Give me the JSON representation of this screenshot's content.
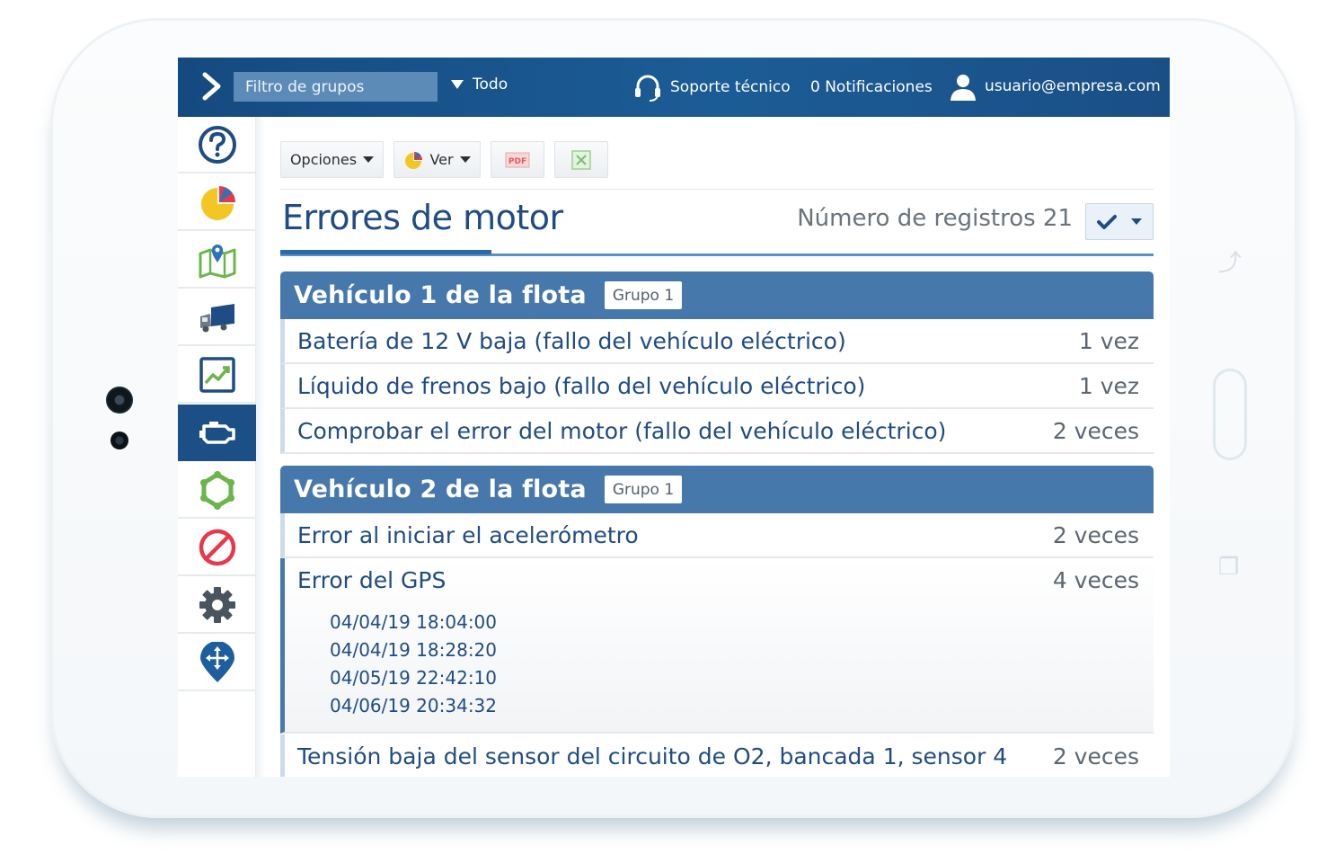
{
  "topbar": {
    "filter_placeholder": "Filtro de grupos",
    "scope_label": "Todo",
    "support_label": "Soporte técnico",
    "notifications_label": "0 Notificaciones",
    "user_email": "usuario@empresa.com"
  },
  "sidebar": {
    "items": [
      {
        "icon": "help-icon"
      },
      {
        "icon": "pie-chart-icon"
      },
      {
        "icon": "map-icon"
      },
      {
        "icon": "truck-icon"
      },
      {
        "icon": "trend-chart-icon"
      },
      {
        "icon": "engine-icon",
        "active": true
      },
      {
        "icon": "rules-icon"
      },
      {
        "icon": "forbidden-icon"
      },
      {
        "icon": "gear-icon"
      },
      {
        "icon": "location-arrows-icon"
      }
    ]
  },
  "toolbar": {
    "options_label": "Opciones",
    "view_label": "Ver",
    "pdf_label": "PDF"
  },
  "page": {
    "title": "Errores de motor",
    "record_count_label": "Número de registros 21"
  },
  "groups": [
    {
      "name": "Vehículo 1 de la flota",
      "badge": "Grupo 1",
      "rows": [
        {
          "name": "Batería de 12 V baja (fallo del vehículo eléctrico)",
          "count": "1 vez"
        },
        {
          "name": "Líquido de frenos bajo (fallo del vehículo eléctrico)",
          "count": "1 vez"
        },
        {
          "name": "Comprobar el error del motor (fallo del vehículo eléctrico)",
          "count": "2 veces"
        }
      ]
    },
    {
      "name": "Vehículo 2 de la flota",
      "badge": "Grupo 1",
      "rows": [
        {
          "name": "Error al iniciar el acelerómetro",
          "count": "2 veces"
        },
        {
          "name": "Error del GPS",
          "count": "4 veces",
          "timestamps": [
            "04/04/19 18:04:00",
            "04/04/19 18:28:20",
            "04/05/19 22:42:10",
            "04/06/19 20:34:32"
          ]
        },
        {
          "name": "Tensión baja del sensor del circuito de O2, bancada 1, sensor 4",
          "count": "2 veces"
        }
      ]
    }
  ],
  "colors": {
    "topbar": "#1c5c96",
    "accent": "#4778ab",
    "active_nav": "#1b4f86",
    "title": "#1f4c84"
  }
}
